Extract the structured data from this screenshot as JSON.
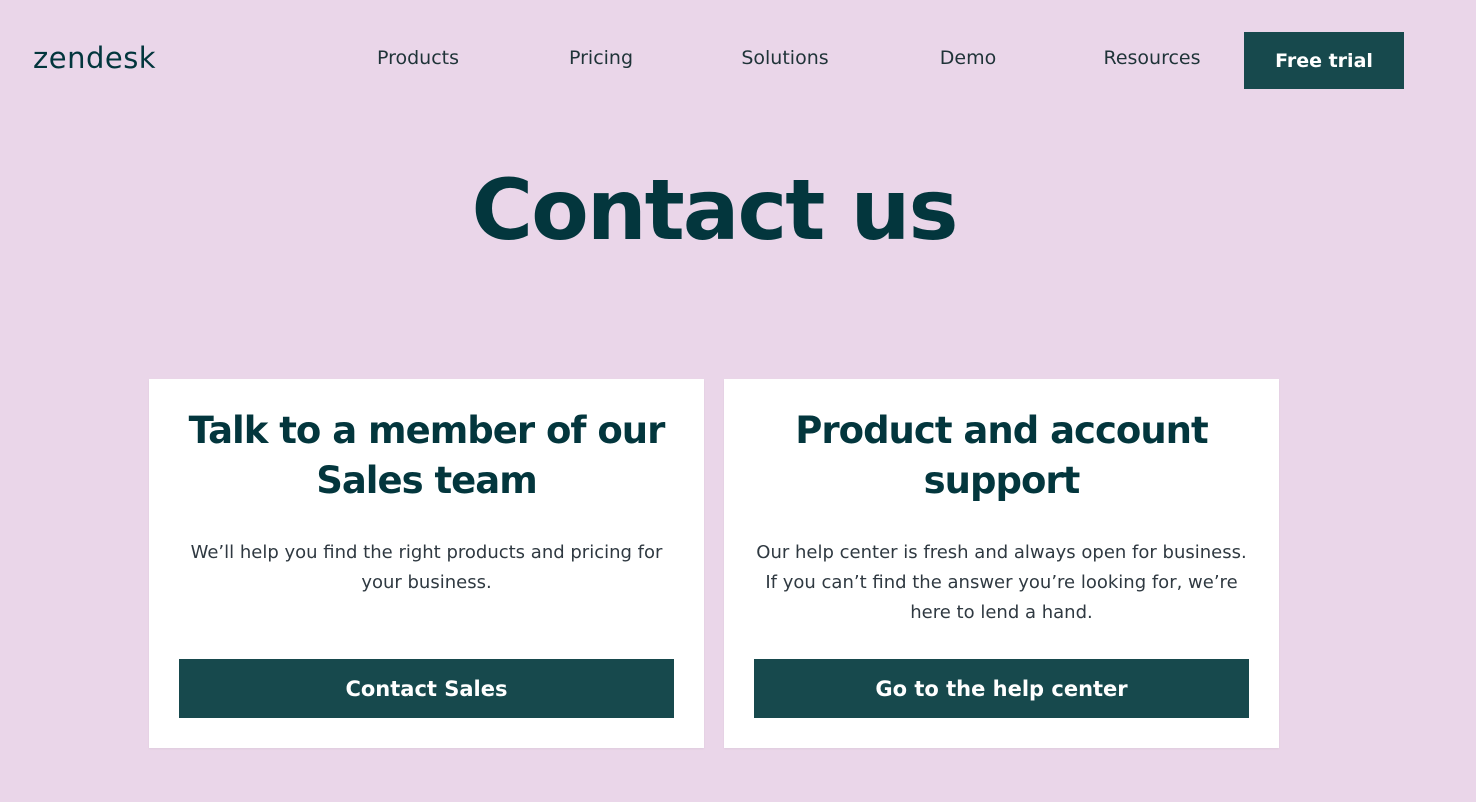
{
  "header": {
    "logo": "zendesk",
    "nav": [
      "Products",
      "Pricing",
      "Solutions",
      "Demo",
      "Resources"
    ],
    "cta": "Free trial"
  },
  "hero": {
    "title": "Contact us"
  },
  "cards": [
    {
      "title": "Talk to a member of our Sales team",
      "text": "We’ll help you find the right products and pricing for your business.",
      "button": "Contact Sales"
    },
    {
      "title": "Product and account support",
      "text": "Our help center is fresh and always open for business. If you can’t find the answer you’re looking for, we’re here to lend a hand.",
      "button": "Go to the help center"
    }
  ],
  "colors": {
    "background": "#ead6e9",
    "brand_dark": "#03363d",
    "button": "#17494d",
    "card": "#ffffff"
  }
}
